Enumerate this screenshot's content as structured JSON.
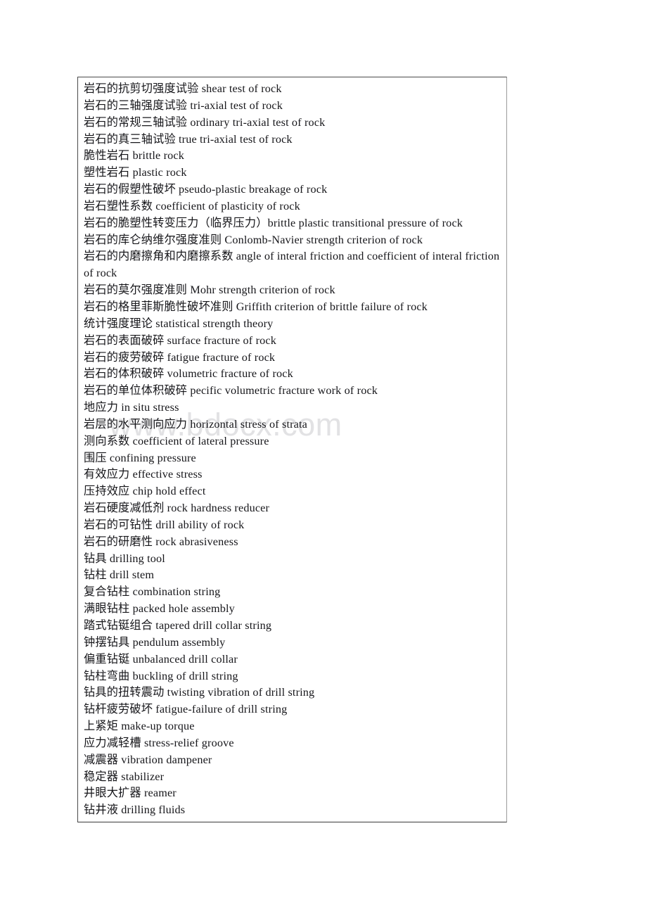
{
  "document": {
    "watermark": "www.bdocx.com",
    "border_color": "#4a4a4a",
    "text_color": "#16161a",
    "watermark_color": "#e2e2e4",
    "background_color": "#ffffff"
  },
  "glossary": {
    "entries": [
      "岩石的抗剪切强度试验 shear test of rock",
      "岩石的三轴强度试验 tri-axial test of rock",
      "岩石的常规三轴试验 ordinary tri-axial test of rock",
      "岩石的真三轴试验 true tri-axial test of rock",
      "脆性岩石 brittle rock",
      "塑性岩石 plastic rock",
      "岩石的假塑性破坏 pseudo-plastic breakage of rock",
      "岩石塑性系数 coefficient of plasticity of rock",
      "岩石的脆塑性转变压力（临界压力）brittle plastic transitional pressure of rock",
      "岩石的库仑纳维尔强度准则 Conlomb-Navier strength criterion of rock",
      "岩石的内磨擦角和内磨擦系数 angle of interal friction and coefficient of interal friction of rock",
      "岩石的莫尔强度准则 Mohr strength criterion of rock",
      "岩石的格里菲斯脆性破坏准则 Griffith criterion of brittle failure of rock",
      "统计强度理论 statistical strength theory",
      "岩石的表面破碎 surface fracture of rock",
      "岩石的疲劳破碎 fatigue fracture of rock",
      "岩石的体积破碎 volumetric fracture of rock",
      "岩石的单位体积破碎 pecific volumetric fracture work of rock",
      "地应力 in situ stress",
      "岩层的水平测向应力 horizontal stress of strata",
      "测向系数 coefficient of lateral pressure",
      "围压 confining pressure",
      "有效应力 effective stress",
      "压持效应 chip hold effect",
      "岩石硬度减低剂 rock hardness reducer",
      "岩石的可钻性 drill ability of rock",
      "岩石的研磨性 rock abrasiveness",
      "钻具 drilling tool",
      "钻柱 drill stem",
      "复合钻柱 combination string",
      "满眼钻柱 packed hole assembly",
      "踏式钻铤组合 tapered drill collar string",
      "钟摆钻具 pendulum assembly",
      "偏重钻铤  unbalanced drill collar",
      "钻柱弯曲 buckling of drill string",
      "钻具的扭转震动 twisting vibration of drill string",
      "钻杆疲劳破坏 fatigue-failure of drill string",
      "上紧矩 make-up torque",
      "应力减轻槽 stress-relief groove",
      "减震器 vibration dampener",
      "稳定器 stabilizer",
      "井眼大扩器 reamer",
      "钻井液 drilling fluids"
    ]
  }
}
